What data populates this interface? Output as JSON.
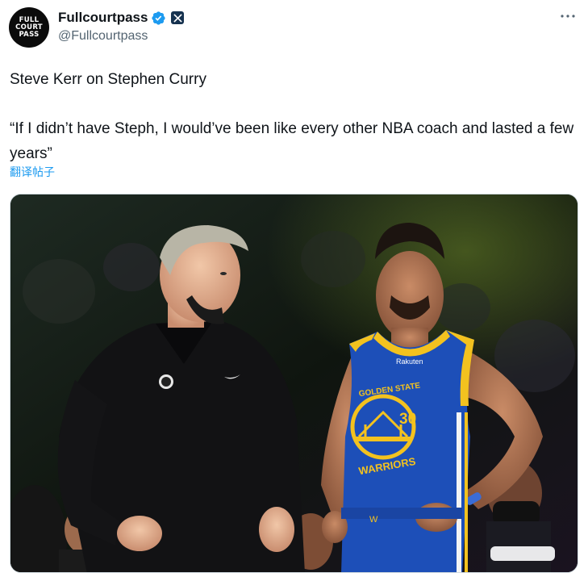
{
  "account": {
    "display_name": "Fullcourtpass",
    "handle": "@Fullcourtpass",
    "avatar_lines": [
      "FULL",
      "COURT",
      "PASS"
    ],
    "verified_icon": "verified-badge-icon",
    "affiliate_icon": "x-logo-icon"
  },
  "tweet": {
    "line1": "Steve Kerr on Stephen Curry",
    "quote": "“If I didn’t have Steph, I would’ve been like every other NBA coach and lasted a few years”",
    "translate_label": "翻译帖子"
  },
  "photo": {
    "jersey_number": "30",
    "team_top": "GOLDEN STATE",
    "team_bottom": "WARRIORS",
    "sponsor": "Rakuten"
  },
  "colors": {
    "link": "#1d9bf0",
    "verified": "#1d9bf0",
    "warriors_blue": "#1d4fb8",
    "warriors_gold": "#f3c21f"
  }
}
